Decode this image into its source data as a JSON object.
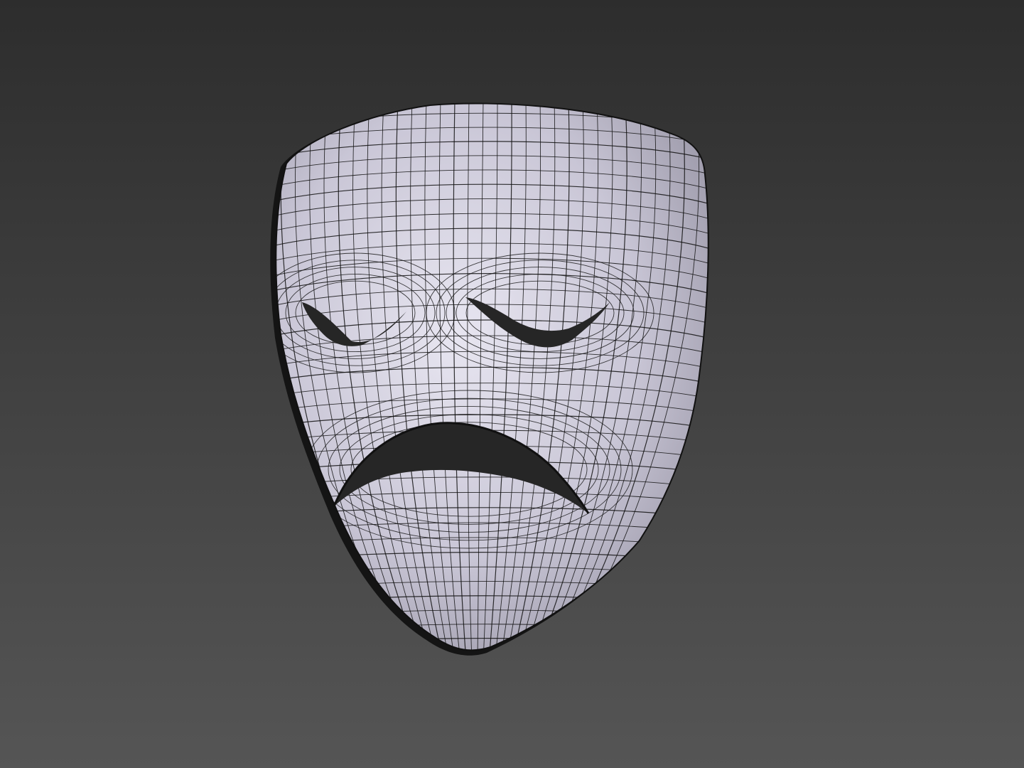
{
  "scene": {
    "background_top": "#2d2d2d",
    "background_bottom": "#555555",
    "mask_fill_light": "#e8e6f1",
    "mask_fill_mid": "#c9c6d6",
    "mask_fill_dark": "#8f8c9c",
    "wire_color": "#111111",
    "hole_color": "#262626",
    "shadow_color": "#141414"
  }
}
